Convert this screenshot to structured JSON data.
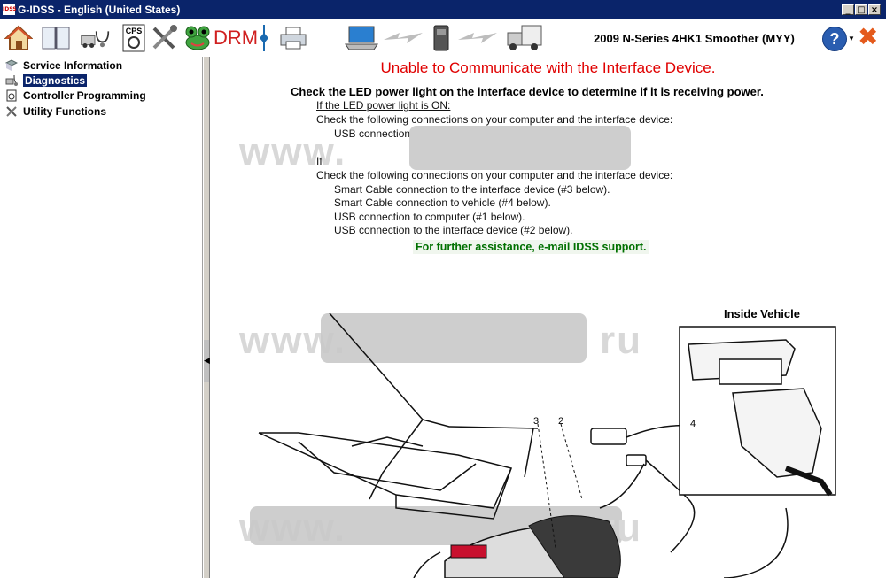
{
  "window": {
    "app_icon": "IDSS",
    "title": "G-IDSS - English (United States)",
    "controls": [
      "_",
      "□",
      "×"
    ]
  },
  "toolbar": {
    "icons": [
      "home-icon",
      "book-icon",
      "vehicle-stethoscope-icon",
      "cps-icon",
      "tools-icon",
      "frog-icon",
      "drm-icon",
      "connector-icon",
      "printer-icon",
      "laptop-icon",
      "lightning-icon",
      "interface-device-icon",
      "lightning-icon",
      "vehicle-icon"
    ],
    "cps_label": "CPS",
    "drm_label": "DRM",
    "vehicle_label": "2009 N-Series 4HK1 Smoother (MYY)",
    "help_label": "?"
  },
  "sidebar": {
    "items": [
      {
        "label": "Service Information",
        "icon": "book-icon"
      },
      {
        "label": "Diagnostics",
        "icon": "stethoscope-icon",
        "selected": true
      },
      {
        "label": "Controller Programming",
        "icon": "chip-icon"
      },
      {
        "label": "Utility Functions",
        "icon": "wrench-icon"
      }
    ]
  },
  "content": {
    "error_title": "Unable to Communicate with the Interface Device.",
    "instruction": "Check the LED power light on the interface device to determine if it is receiving power.",
    "led_on_heading": "If the LED power light is ON:",
    "led_on_check": "Check the following connections on your computer and the interface device:",
    "led_on_items": [
      "USB connection"
    ],
    "led_off_heading": "If",
    "led_off_check": "Check the following connections on your computer and the interface device:",
    "led_off_items": [
      "Smart Cable connection to the interface device (#3 below).",
      "Smart Cable connection to vehicle (#4 below).",
      "USB connection to computer (#1 below).",
      "USB connection to the interface device (#2 below)."
    ],
    "support_text": "For further assistance, e-mail IDSS support."
  },
  "diagram": {
    "inside_vehicle_label": "Inside Vehicle",
    "callouts": [
      "3",
      "2",
      "4"
    ],
    "watermark": "www.",
    "watermark_suffix": "ru"
  }
}
